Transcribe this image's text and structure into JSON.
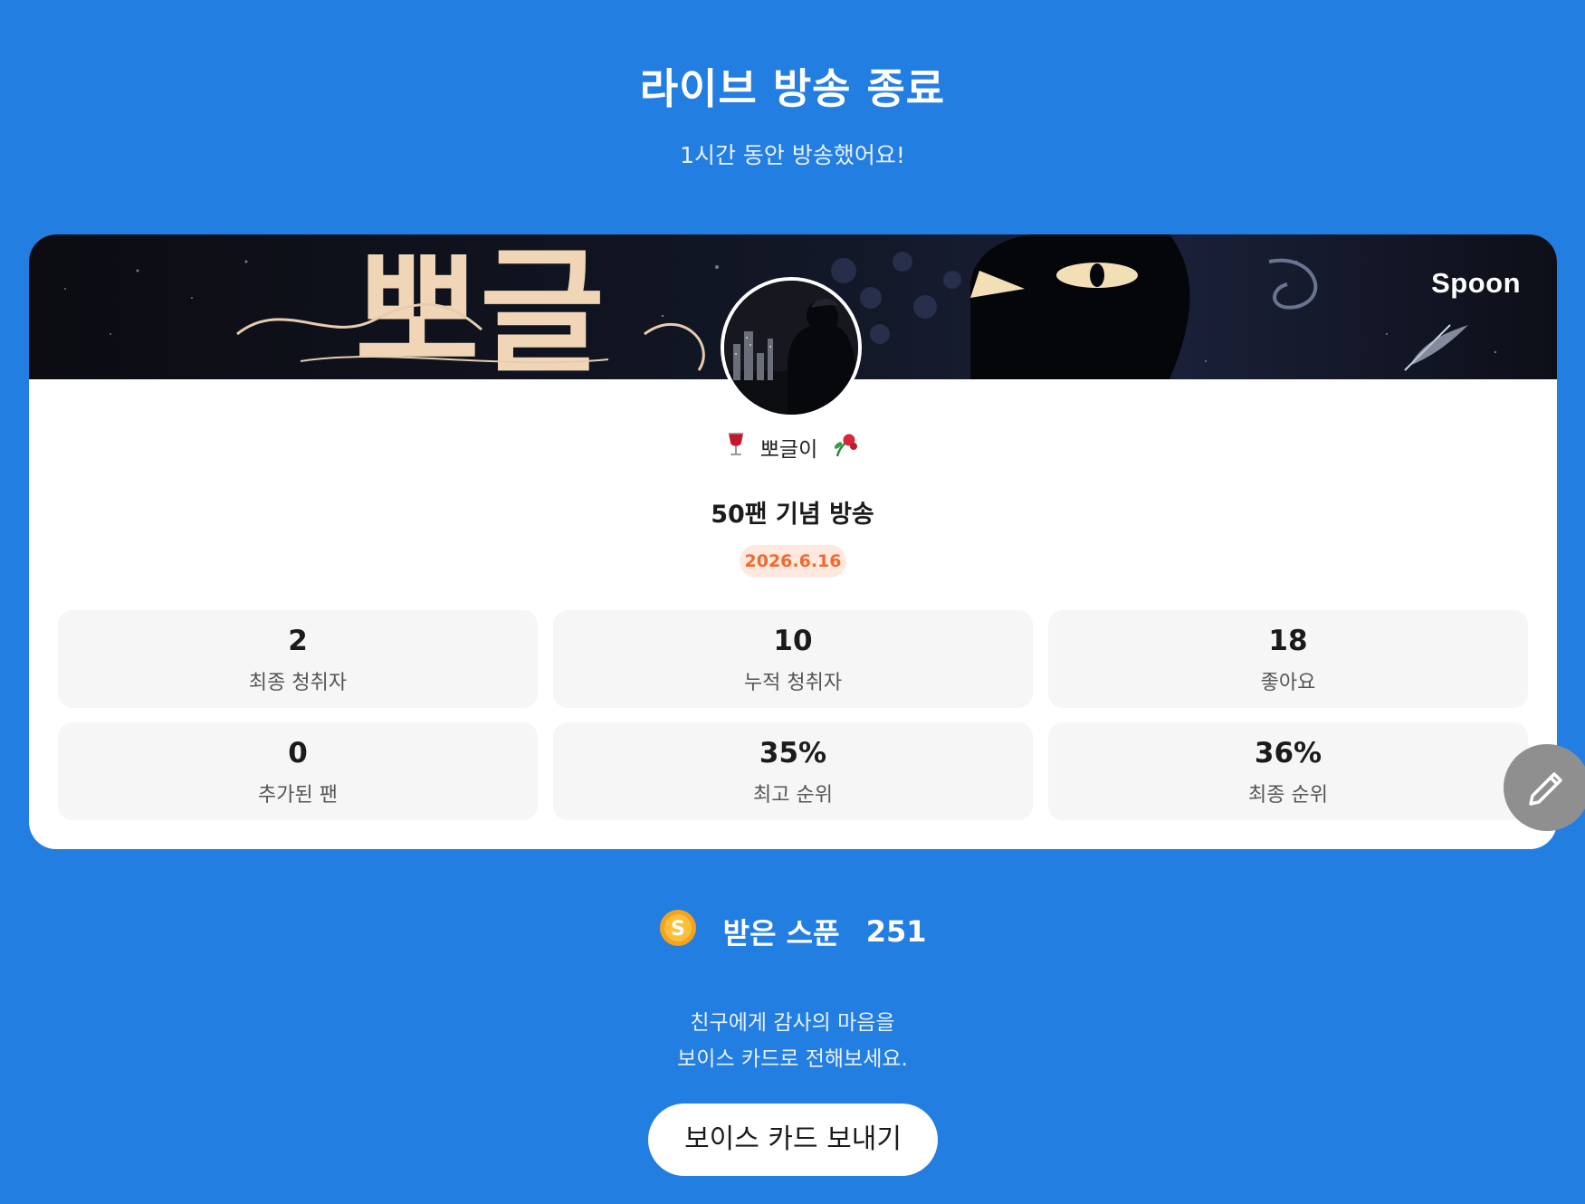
{
  "header": {
    "title": "라이브 방송 종료",
    "subtitle": "1시간 동안 방송했어요!"
  },
  "card": {
    "banner": {
      "art_text": "뽀글",
      "brand": "Spoon"
    },
    "profile": {
      "emoji_left": "🍷",
      "nickname": "뽀글이",
      "emoji_right": "🥀"
    },
    "broadcast_title": "50팬 기념 방송",
    "date": "2026.6.16",
    "stats": [
      {
        "value": "2",
        "label": "최종 청취자"
      },
      {
        "value": "10",
        "label": "누적 청취자"
      },
      {
        "value": "18",
        "label": "좋아요"
      },
      {
        "value": "0",
        "label": "추가된 팬"
      },
      {
        "value": "35%",
        "label": "최고 순위"
      },
      {
        "value": "36%",
        "label": "최종 순위"
      }
    ]
  },
  "spoons": {
    "coin_icon": "spoon-coin-icon",
    "label": "받은 스푼",
    "value": "251"
  },
  "promo": {
    "line1": "친구에게 감사의 마음을",
    "line2": "보이스 카드로 전해보세요.",
    "button_label": "보이스 카드 보내기"
  },
  "colors": {
    "background": "#237ee2",
    "card": "#ffffff",
    "stat_tile": "#f6f6f6",
    "date_badge_bg": "#ffe8de",
    "date_badge_text": "#ef6a2f",
    "edit_fab": "#8f8f8f"
  }
}
